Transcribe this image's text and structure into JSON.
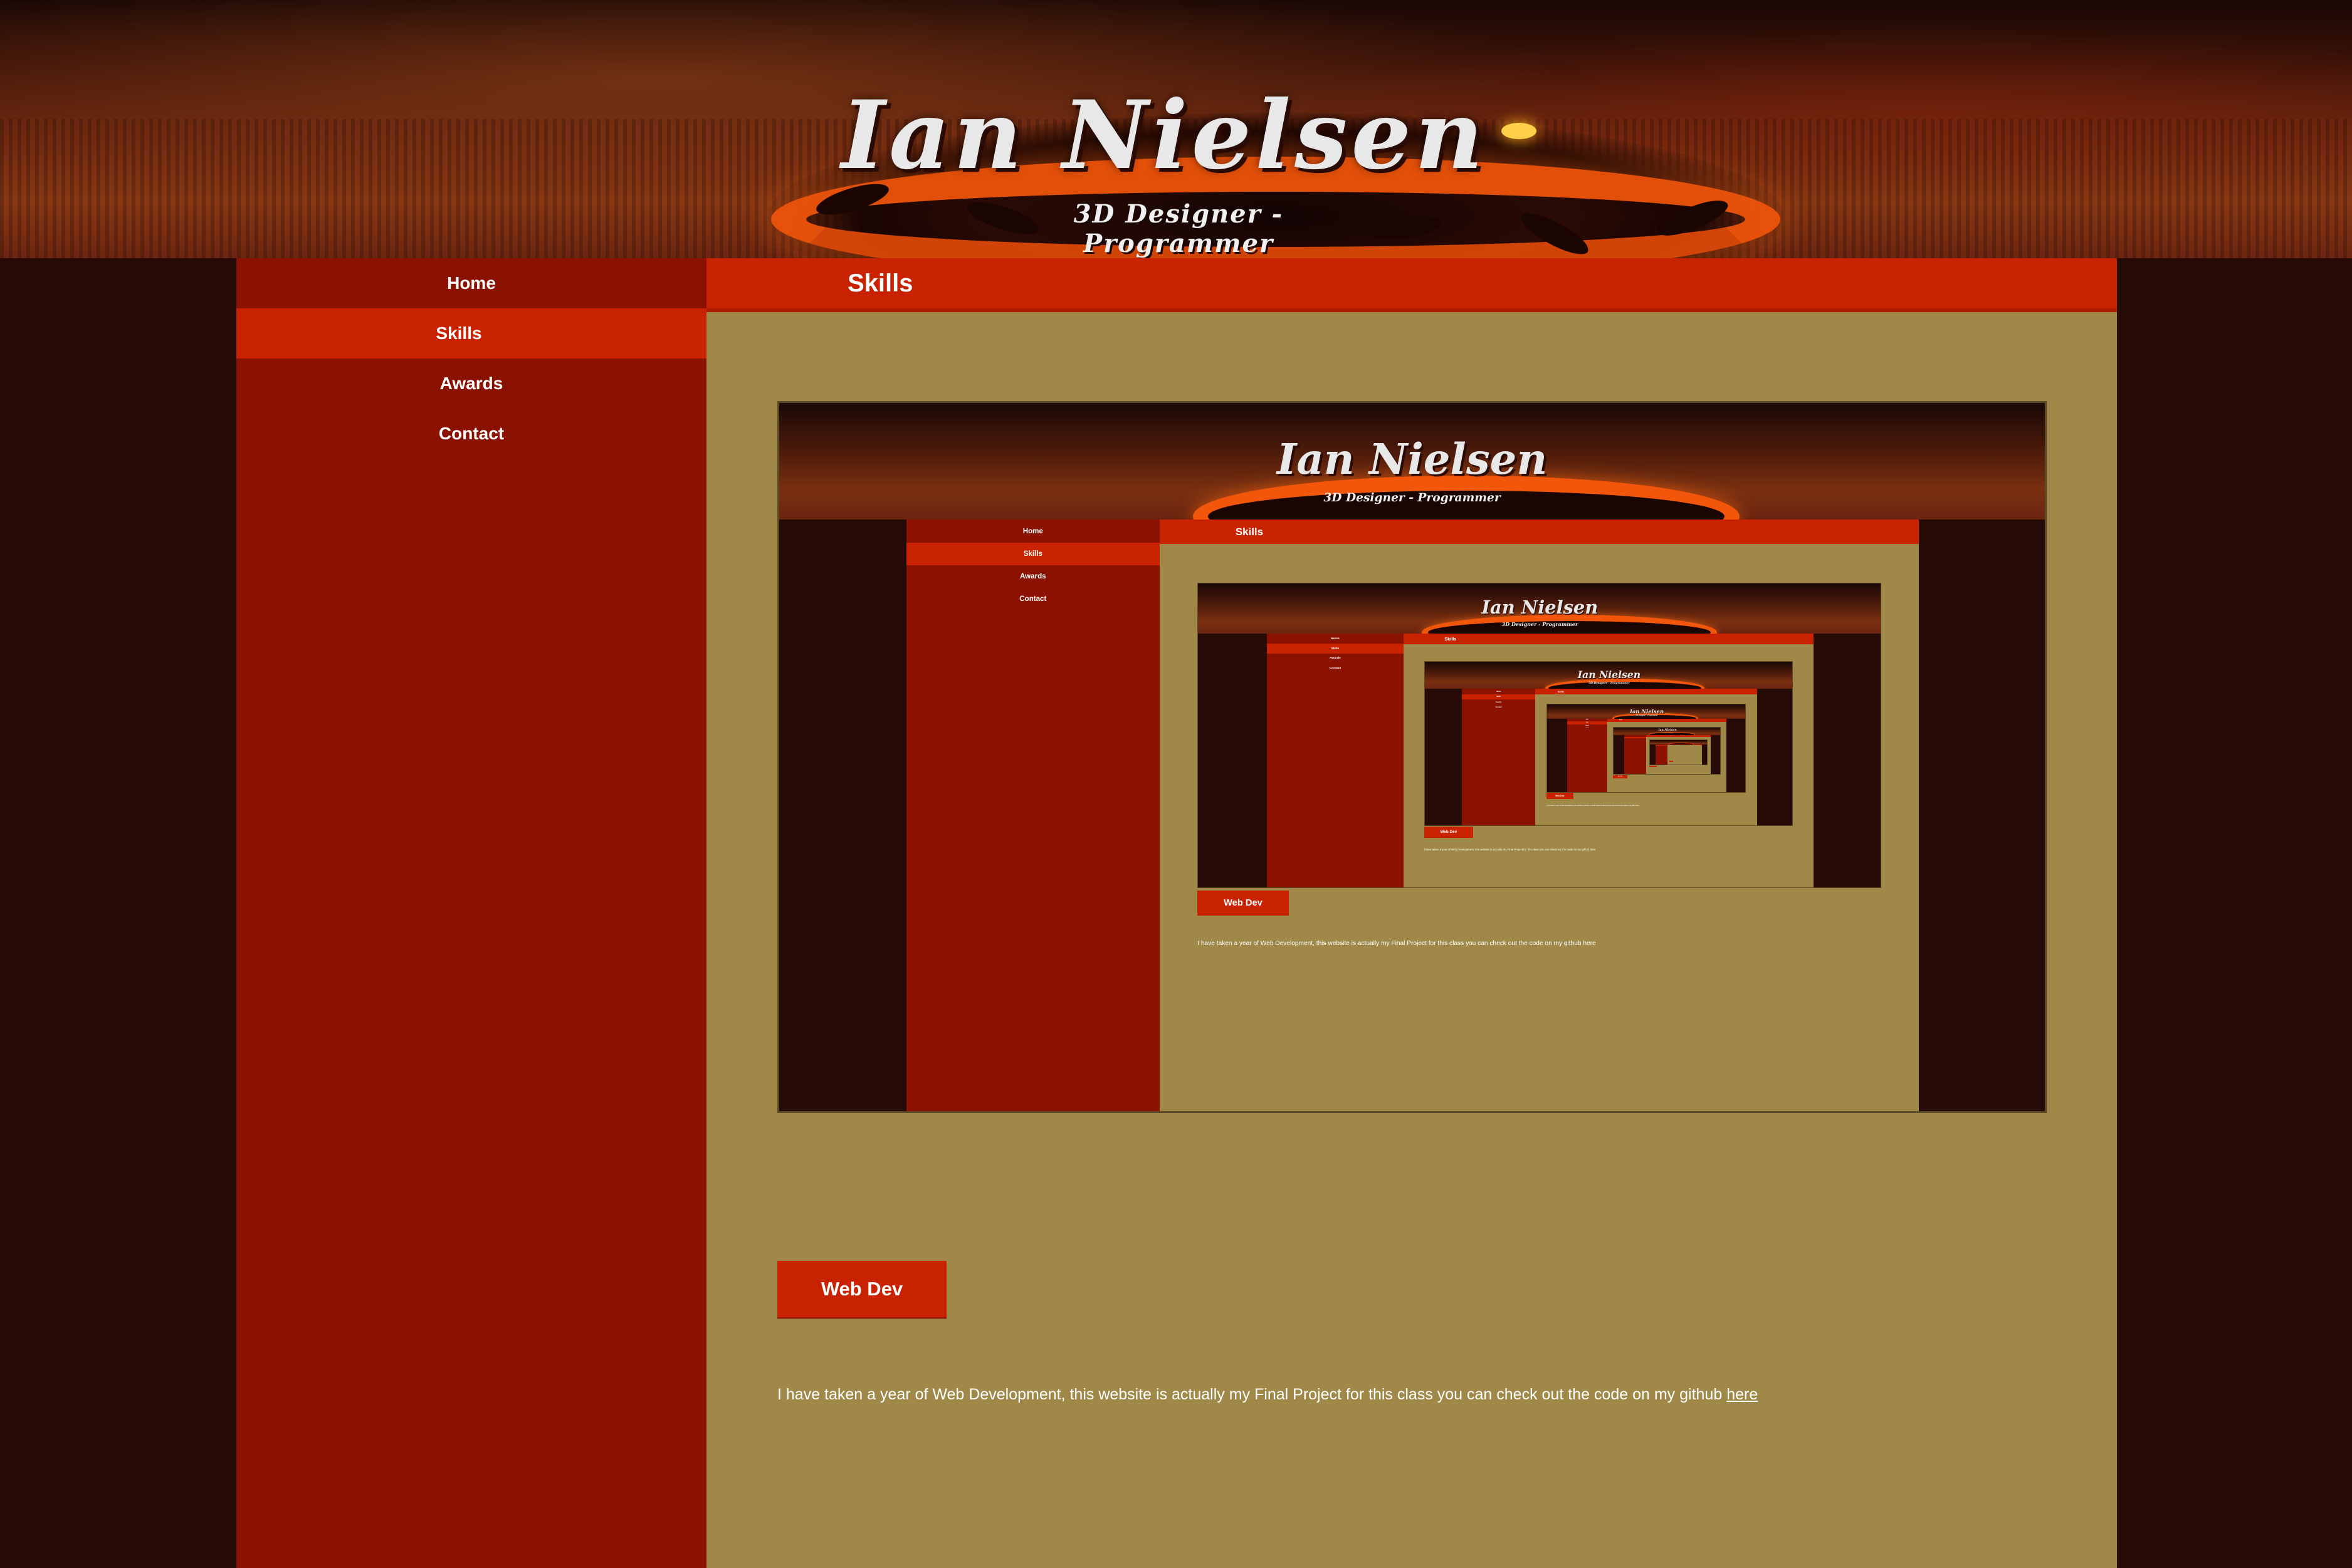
{
  "site": {
    "title": "Ian Nielsen",
    "subtitle": "3D Designer - Programmer"
  },
  "nav": {
    "items": [
      {
        "label": "Home",
        "active": false
      },
      {
        "label": "Skills",
        "active": true
      },
      {
        "label": "Awards",
        "active": false
      },
      {
        "label": "Contact",
        "active": false
      }
    ]
  },
  "section": {
    "title": "Skills"
  },
  "skill": {
    "button_label": "Web Dev",
    "description": "I have taken a year of Web Development, this website is actually my Final Project for this class you can check out the code on my github",
    "link_text": "here"
  },
  "colors": {
    "sidebar": "#8b1200",
    "accent": "#c82200",
    "content_bg": "#a08848",
    "page_bg": "#250a05",
    "text": "#ffffff"
  },
  "preview": {
    "description": "Recursive screenshot of this same page",
    "nesting_depth": 6
  }
}
